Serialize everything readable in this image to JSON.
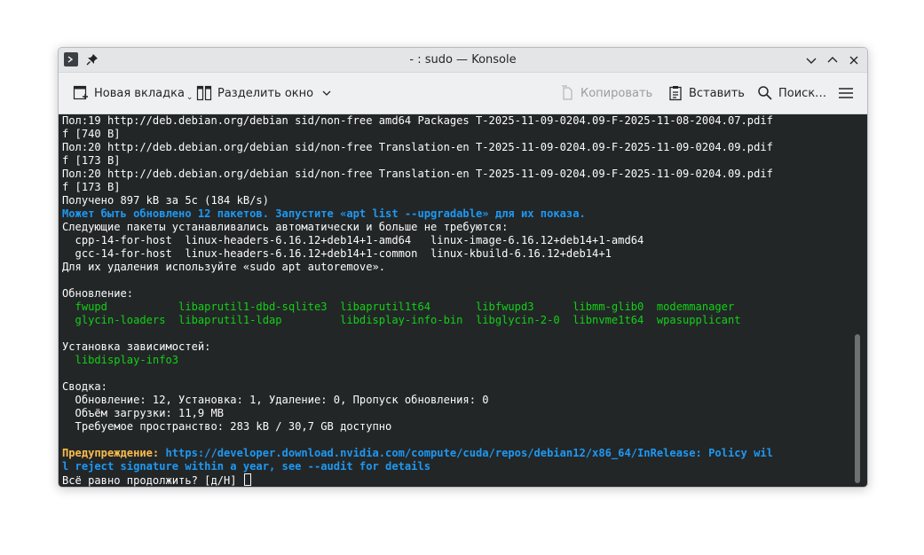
{
  "window": {
    "title": "- : sudo — Konsole"
  },
  "toolbar": {
    "new_tab": "Новая вкладка",
    "split_view": "Разделить окно",
    "copy": "Копировать",
    "paste": "Вставить",
    "search": "Поиск…"
  },
  "terminal": {
    "lines": [
      [
        {
          "t": "Пол:19 http://deb.debian.org/debian sid/non-free amd64 Packages T-2025-11-09-0204.09-F-2025-11-08-2004.07.pdif"
        }
      ],
      [
        {
          "t": "f [740 B]"
        }
      ],
      [
        {
          "t": "Пол:20 http://deb.debian.org/debian sid/non-free Translation-en T-2025-11-09-0204.09-F-2025-11-09-0204.09.pdif"
        }
      ],
      [
        {
          "t": "f [173 B]"
        }
      ],
      [
        {
          "t": "Пол:20 http://deb.debian.org/debian sid/non-free Translation-en T-2025-11-09-0204.09-F-2025-11-09-0204.09.pdif"
        }
      ],
      [
        {
          "t": "f [173 B]"
        }
      ],
      [
        {
          "t": "Получено 897 kB за 5c (184 kB/s)"
        }
      ],
      [
        {
          "t": "Может быть обновлено 12 пакетов. Запустите «apt list --upgradable» для их показа.",
          "c": "blue b"
        }
      ],
      [
        {
          "t": "Следующие пакеты устанавливались автоматически и больше не требуются:"
        }
      ],
      [
        {
          "t": "  cpp-14-for-host  linux-headers-6.16.12+deb14+1-amd64   linux-image-6.16.12+deb14+1-amd64"
        }
      ],
      [
        {
          "t": "  gcc-14-for-host  linux-headers-6.16.12+deb14+1-common  linux-kbuild-6.16.12+deb14+1"
        }
      ],
      [
        {
          "t": "Для их удаления используйте «sudo apt autoremove»."
        }
      ],
      [
        {
          "t": ""
        }
      ],
      [
        {
          "t": "Обновление:"
        }
      ],
      [
        {
          "t": "  fwupd           libaprutil1-dbd-sqlite3  libaprutil1t64       libfwupd3      libmm-glib0  modemmanager",
          "c": "green2"
        }
      ],
      [
        {
          "t": "  glycin-loaders  libaprutil1-ldap         libdisplay-info-bin  libglycin-2-0  libnvme1t64  wpasupplicant",
          "c": "green2"
        }
      ],
      [
        {
          "t": ""
        }
      ],
      [
        {
          "t": "Установка зависимостей:"
        }
      ],
      [
        {
          "t": "  libdisplay-info3",
          "c": "green2"
        }
      ],
      [
        {
          "t": ""
        }
      ],
      [
        {
          "t": "Сводка:"
        }
      ],
      [
        {
          "t": "  Обновление: 12, Установка: 1, Удаление: 0, Пропуск обновления: 0"
        }
      ],
      [
        {
          "t": "  Объём загрузки: 11,9 MB"
        }
      ],
      [
        {
          "t": "  Требуемое пространство: 283 kB / 30,7 GB доступно"
        }
      ],
      [
        {
          "t": ""
        }
      ],
      [
        {
          "t": "Предупреждение:",
          "c": "yellow b"
        },
        {
          "t": " https://developer.download.nvidia.com/compute/cuda/repos/debian12/x86_64/InRelease: Policy wil",
          "c": "blue b"
        }
      ],
      [
        {
          "t": "l reject signature within a year, see --audit for details",
          "c": "blue b"
        }
      ],
      [
        {
          "t": "Всё равно продолжить? [д/Н] "
        }
      ]
    ]
  }
}
